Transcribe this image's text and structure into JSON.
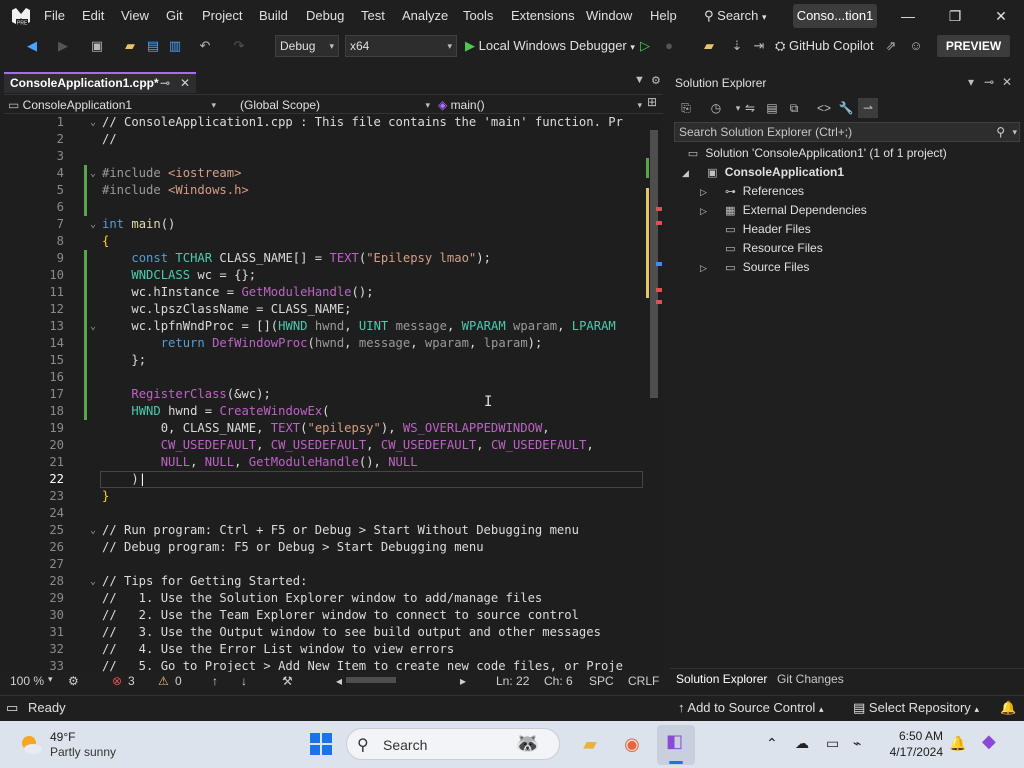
{
  "menubar": {
    "items": [
      "File",
      "Edit",
      "View",
      "Git",
      "Project",
      "Build",
      "Debug",
      "Test",
      "Analyze",
      "Tools",
      "Extensions",
      "Window",
      "Help"
    ],
    "search_label": "Search",
    "solution_chip": "Conso...tion1"
  },
  "toolbar": {
    "config": "Debug",
    "platform": "x64",
    "debugger": "Local Windows Debugger",
    "copilot": "GitHub Copilot",
    "preview": "PREVIEW"
  },
  "editor": {
    "tab_label": "ConsoleApplication1.cpp*",
    "nav_project": "ConsoleApplication1",
    "nav_scope": "(Global Scope)",
    "nav_member": "main()",
    "current_line": 22,
    "line_numbers": [
      "1",
      "2",
      "3",
      "4",
      "5",
      "6",
      "7",
      "8",
      "9",
      "10",
      "11",
      "12",
      "13",
      "14",
      "15",
      "16",
      "17",
      "18",
      "19",
      "20",
      "21",
      "22",
      "23",
      "24",
      "25",
      "26",
      "27",
      "28",
      "29",
      "30",
      "31",
      "32",
      "33"
    ],
    "code_comments": {
      "l1": "// ConsoleApplication1.cpp : This file contains the 'main' function. Pr",
      "l2": "//",
      "l25": "// Run program: Ctrl + F5 or Debug > Start Without Debugging menu",
      "l26": "// Debug program: F5 or Debug > Start Debugging menu",
      "l28": "// Tips for Getting Started:",
      "l29": "//   1. Use the Solution Explorer window to add/manage files",
      "l30": "//   2. Use the Team Explorer window to connect to source control",
      "l31": "//   3. Use the Output window to see build output and other messages",
      "l32": "//   4. Use the Error List window to view errors",
      "l33": "//   5. Go to Project > Add New Item to create new code files, or Proje"
    },
    "strings": {
      "class_name": "\"Epilepsy lmao\"",
      "window_title": "\"epilepsy\"",
      "include1": "<iostream>",
      "include2": "<Windows.h>"
    }
  },
  "editor_status": {
    "zoom": "100 %",
    "errors": "3",
    "warnings": "0",
    "line": "Ln: 22",
    "col": "Ch: 6",
    "whitespace": "SPC",
    "eol": "CRLF"
  },
  "solution_explorer": {
    "title": "Solution Explorer",
    "search_placeholder": "Search Solution Explorer (Ctrl+;)",
    "solution": "Solution 'ConsoleApplication1' (1 of 1 project)",
    "project": "ConsoleApplication1",
    "nodes": [
      "References",
      "External Dependencies",
      "Header Files",
      "Resource Files",
      "Source Files"
    ],
    "bottom_tabs": [
      "Solution Explorer",
      "Git Changes"
    ]
  },
  "statusbar": {
    "ready": "Ready",
    "source_control": "Add to Source Control",
    "repository": "Select Repository"
  },
  "taskbar": {
    "temperature": "49°F",
    "weather": "Partly sunny",
    "search": "Search",
    "time": "6:50 AM",
    "date": "4/17/2024"
  },
  "colors": {
    "accent": "#a46ef0",
    "comment": "#57a64a",
    "keyword": "#569cd6",
    "string": "#d69d85",
    "type": "#4ec9b0",
    "macro": "#bd63c5",
    "function": "#dcdcaa",
    "variable": "#9cdcfe"
  }
}
